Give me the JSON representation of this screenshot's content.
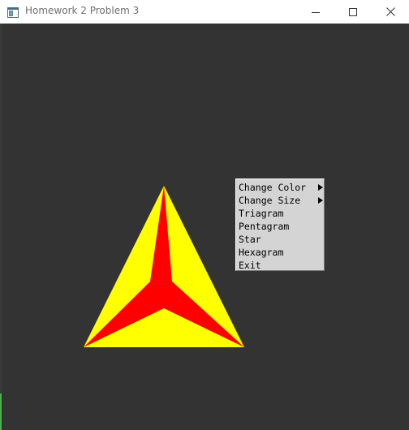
{
  "window": {
    "title": "Homework 2 Problem 3",
    "icon": "app-window-icon",
    "controls": [
      "minimize-icon",
      "maximize-icon",
      "close-icon"
    ]
  },
  "canvas": {
    "background": "#333333",
    "shape": {
      "type": "triagram",
      "outer_fill": "#ffff00",
      "inner_fill": "#ff0000"
    }
  },
  "context_menu": {
    "items": [
      {
        "label": "Change Color",
        "submenu": true
      },
      {
        "label": "Change Size",
        "submenu": true
      },
      {
        "label": "Triagram",
        "submenu": false
      },
      {
        "label": "Pentagram",
        "submenu": false
      },
      {
        "label": "Star",
        "submenu": false
      },
      {
        "label": "Hexagram",
        "submenu": false
      },
      {
        "label": "Exit",
        "submenu": false
      }
    ]
  }
}
